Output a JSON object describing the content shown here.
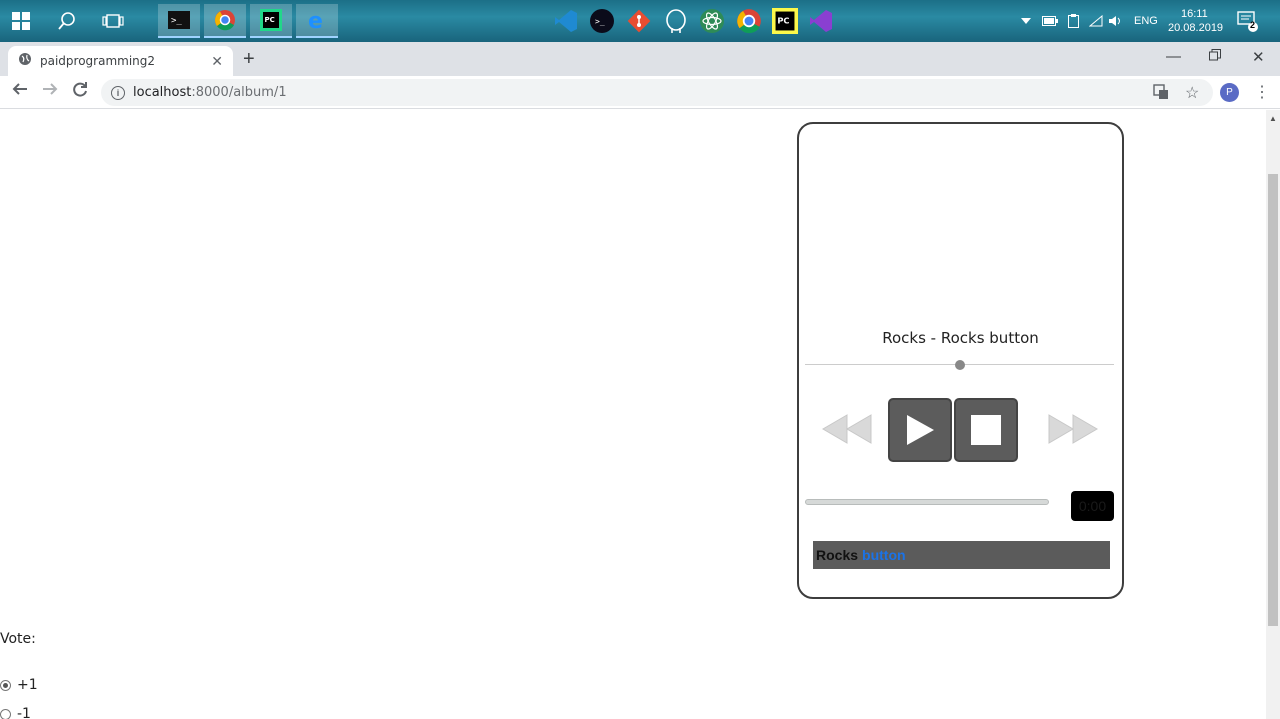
{
  "taskbar": {
    "tray_lang": "ENG",
    "clock_time": "16:11",
    "clock_date": "20.08.2019",
    "notification_count": "2"
  },
  "browser": {
    "tab_title": "paidprogramming2",
    "url_host": "localhost",
    "url_path": ":8000/album/1",
    "profile_initial": "P"
  },
  "player": {
    "track_title": "Rocks - Rocks button",
    "time_display": "0:00",
    "now_playing_name": "Rocks",
    "now_playing_link": "button",
    "seek_position": 0.5,
    "progress": 0
  },
  "vote": {
    "label": "Vote:",
    "options": [
      {
        "label": "+1",
        "selected": true
      },
      {
        "label": "-1",
        "selected": false
      }
    ]
  }
}
